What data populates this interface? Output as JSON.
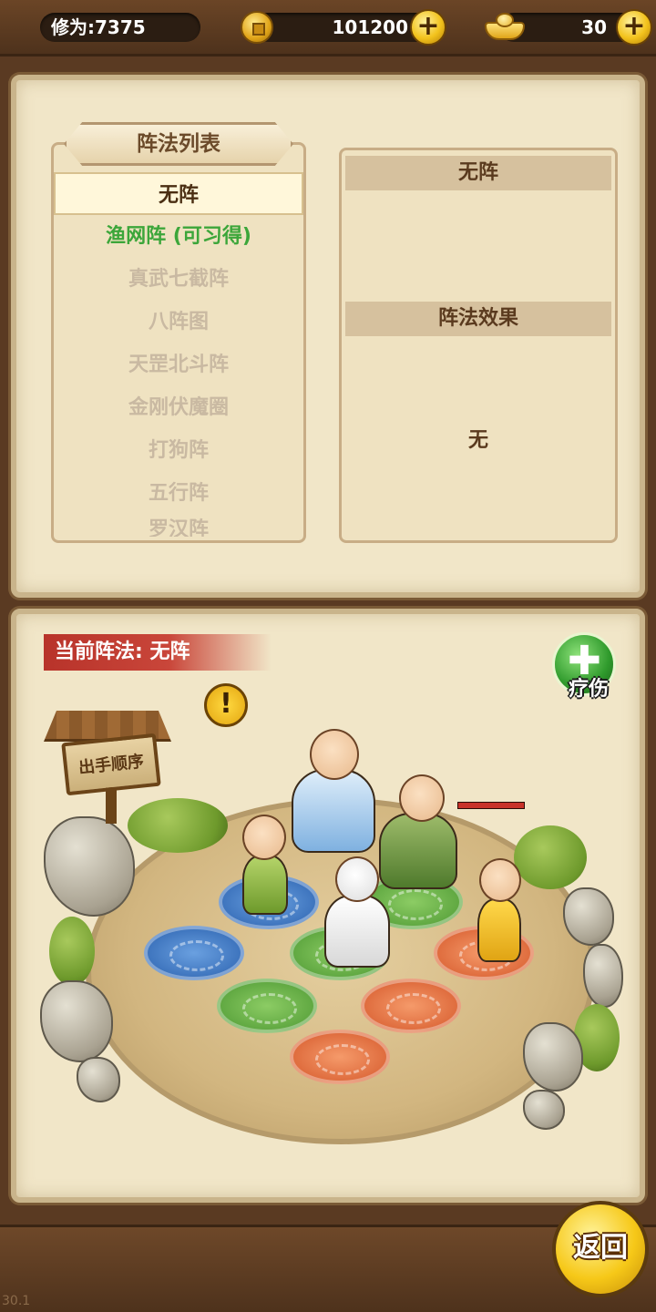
{
  "top_bar": {
    "cultivation": "修为:7375",
    "copper": "101200",
    "gold_ingot": "30",
    "plus_symbol": "+"
  },
  "formation_list": {
    "title": "阵法列表",
    "items": [
      {
        "label": "无阵",
        "state": "selected"
      },
      {
        "label": "渔网阵 (可习得)",
        "state": "learnable"
      },
      {
        "label": "真武七截阵",
        "state": "locked"
      },
      {
        "label": "八阵图",
        "state": "locked"
      },
      {
        "label": "天罡北斗阵",
        "state": "locked"
      },
      {
        "label": "金刚伏魔圈",
        "state": "locked"
      },
      {
        "label": "打狗阵",
        "state": "locked"
      },
      {
        "label": "五行阵",
        "state": "locked"
      },
      {
        "label": "罗汉阵",
        "state": "locked"
      }
    ]
  },
  "detail": {
    "name": "无阵",
    "effect_heading": "阵法效果",
    "effect_value": "无"
  },
  "battle": {
    "current_formation": "当前阵法: 无阵",
    "heal_label": "疗伤",
    "heal_symbol": "✚",
    "warning_symbol": "!",
    "order_sign": "出手顺序"
  },
  "back_label": "返回",
  "version": "30.1",
  "colors": {
    "learnable": "#3ca63a",
    "locked": "#c9b9a2",
    "banner": "#b8332a"
  },
  "icons": [
    "copper-coin-icon",
    "gold-ingot-icon",
    "plus-icon",
    "warning-icon",
    "heal-icon"
  ]
}
